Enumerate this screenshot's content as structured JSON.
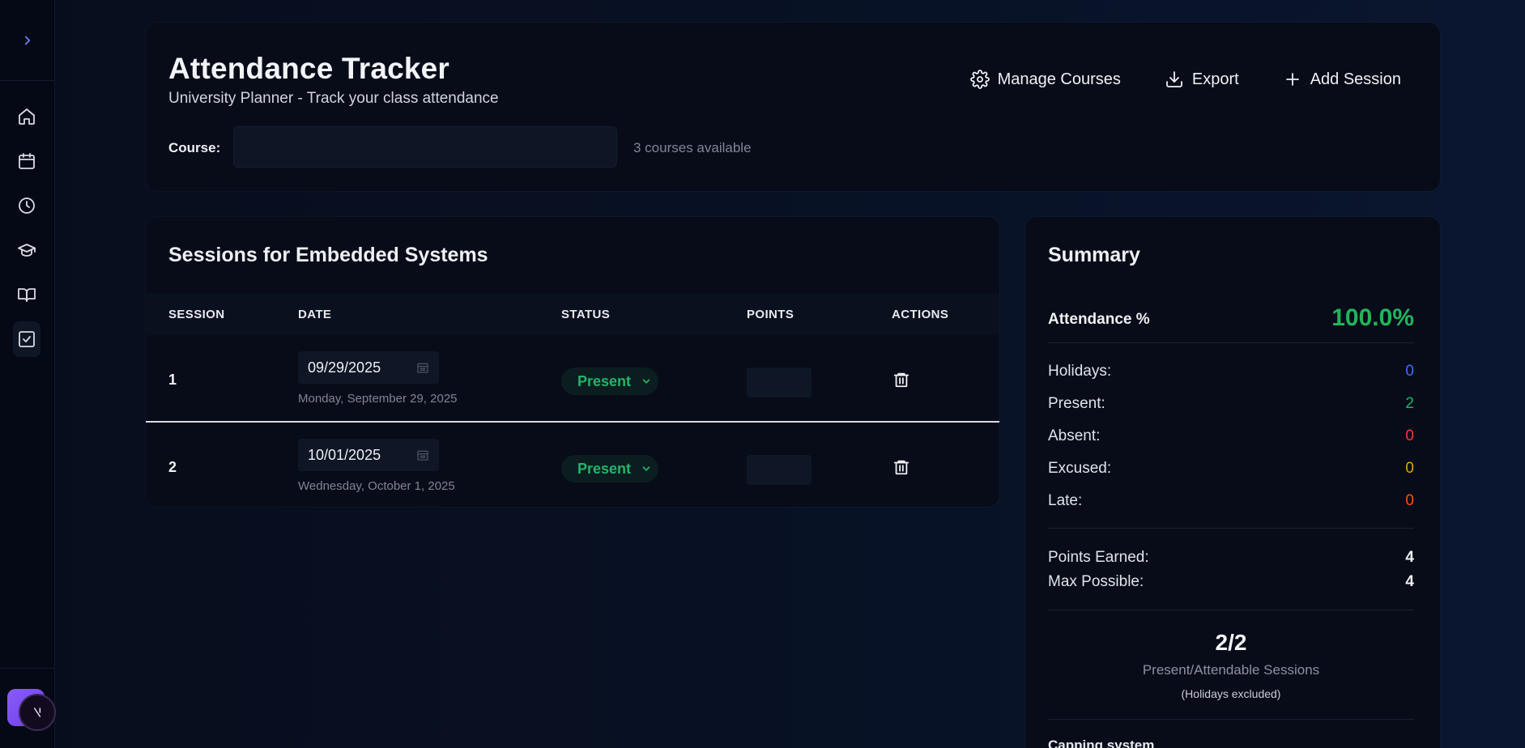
{
  "sidebar": {
    "expand_icon": "chevron-right-icon",
    "items": [
      {
        "name": "home",
        "icon": "home-icon"
      },
      {
        "name": "calendar",
        "icon": "calendar-icon"
      },
      {
        "name": "clock",
        "icon": "clock-icon"
      },
      {
        "name": "courses",
        "icon": "graduation-cap-icon"
      },
      {
        "name": "notes",
        "icon": "book-open-icon"
      },
      {
        "name": "attendance",
        "icon": "check-square-icon",
        "active": true
      }
    ],
    "avatar_glyph": "N"
  },
  "header": {
    "title": "Attendance Tracker",
    "subtitle": "University Planner - Track your class attendance",
    "actions": {
      "manage_courses": "Manage Courses",
      "export": "Export",
      "add_session": "Add Session"
    },
    "course_label": "Course:",
    "course_value": "",
    "course_count": "3 courses available"
  },
  "sessions": {
    "title": "Sessions for Embedded Systems",
    "columns": [
      "SESSION",
      "DATE",
      "STATUS",
      "POINTS",
      "ACTIONS"
    ],
    "rows": [
      {
        "session": "1",
        "date": "09/29/2025",
        "date_long": "Monday, September 29, 2025",
        "status": "Present",
        "points": ""
      },
      {
        "session": "2",
        "date": "10/01/2025",
        "date_long": "Wednesday, October 1, 2025",
        "status": "Present",
        "points": ""
      }
    ]
  },
  "summary": {
    "title": "Summary",
    "attendance_label": "Attendance %",
    "attendance_value": "100.0%",
    "stats": [
      {
        "label": "Holidays:",
        "value": "0",
        "color": "#3b6ff5"
      },
      {
        "label": "Present:",
        "value": "2",
        "color": "#22b45c"
      },
      {
        "label": "Absent:",
        "value": "0",
        "color": "#ef3b3b"
      },
      {
        "label": "Excused:",
        "value": "0",
        "color": "#e0a21a"
      },
      {
        "label": "Late:",
        "value": "0",
        "color": "#f0541e"
      }
    ],
    "points_earned_label": "Points Earned:",
    "points_earned": "4",
    "max_possible_label": "Max Possible:",
    "max_possible": "4",
    "ratio": "2/2",
    "ratio_label": "Present/Attendable Sessions",
    "ratio_note": "(Holidays excluded)",
    "capping_label": "Capping system"
  },
  "colors": {
    "accent": "#7b7ff7",
    "present": "#22b46a",
    "background": "#050a16",
    "card": "#070c18"
  }
}
